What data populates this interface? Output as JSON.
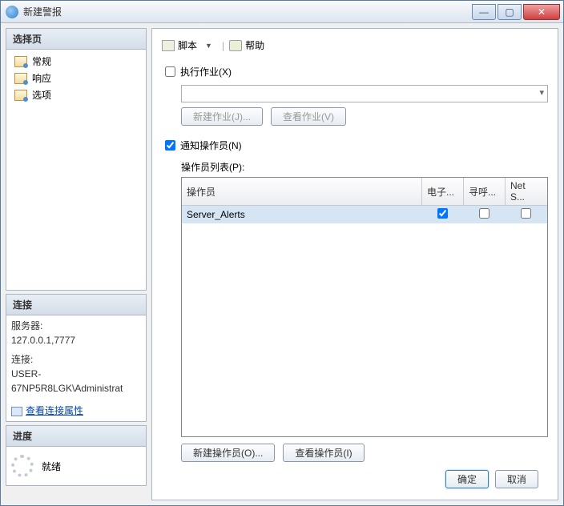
{
  "window": {
    "title": "新建警报"
  },
  "sidebar": {
    "select_page": {
      "header": "选择页",
      "items": [
        "常规",
        "响应",
        "选项"
      ],
      "selected_index": 1
    },
    "connection": {
      "header": "连接",
      "server_label": "服务器:",
      "server_value": "127.0.0.1,7777",
      "conn_label": "连接:",
      "conn_value": "USER-67NP5R8LGK\\Administrat",
      "view_link": "查看连接属性"
    },
    "progress": {
      "header": "进度",
      "status": "就绪"
    }
  },
  "toolbar": {
    "script": "脚本",
    "help": "帮助"
  },
  "form": {
    "execute_job": {
      "label": "执行作业(X)",
      "checked": false
    },
    "new_job_btn": "新建作业(J)...",
    "view_job_btn": "查看作业(V)",
    "notify_operator": {
      "label": "通知操作员(N)",
      "checked": true
    },
    "operator_list_label": "操作员列表(P):",
    "grid": {
      "cols": [
        "操作员",
        "电子...",
        "寻呼...",
        "Net S..."
      ],
      "rows": [
        {
          "name": "Server_Alerts",
          "email": true,
          "pager": false,
          "netsend": false
        }
      ]
    },
    "new_operator_btn": "新建操作员(O)...",
    "view_operator_btn": "查看操作员(I)"
  },
  "footer": {
    "ok": "确定",
    "cancel": "取消"
  }
}
